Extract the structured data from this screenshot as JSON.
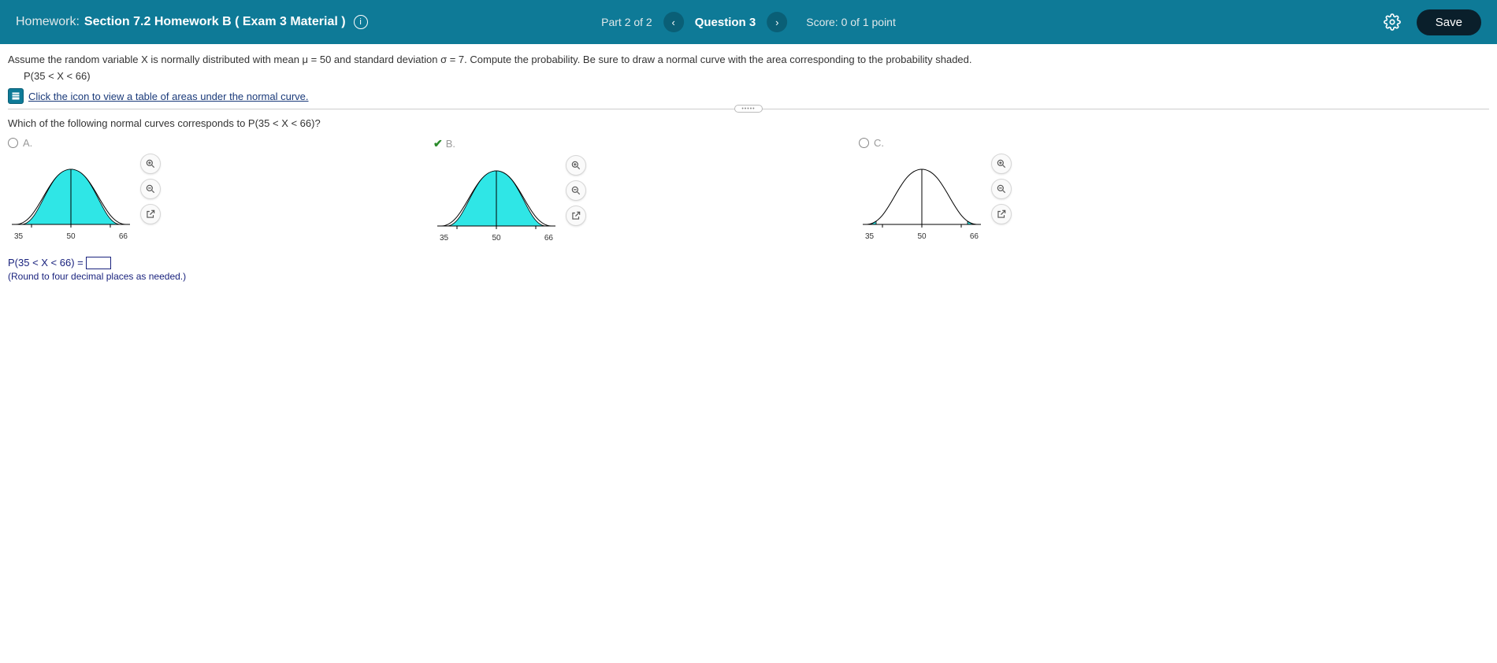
{
  "header": {
    "homework_label": "Homework:",
    "homework_title": "Section 7.2 Homework B ( Exam 3 Material )",
    "part_text": "Part 2 of 2",
    "question_text": "Question 3",
    "score_text": "Score: 0 of 1 point",
    "save_label": "Save"
  },
  "problem": {
    "statement": "Assume the random variable X is normally distributed with mean μ = 50 and standard deviation σ = 7. Compute the probability. Be sure to draw a normal curve with the area corresponding to the probability shaded.",
    "expression": "P(35 < X < 66)",
    "link_text": "Click the icon to view a table of areas under the normal curve."
  },
  "question": {
    "prompt": "Which of the following normal curves corresponds to P(35 < X < 66)?",
    "options": [
      {
        "label": "A.",
        "selected": false,
        "correct": false,
        "ticks": [
          "35",
          "50",
          "66"
        ],
        "shade": "full"
      },
      {
        "label": "B.",
        "selected": true,
        "correct": true,
        "ticks": [
          "35",
          "50",
          "66"
        ],
        "shade": "full"
      },
      {
        "label": "C.",
        "selected": false,
        "correct": false,
        "ticks": [
          "35",
          "50",
          "66"
        ],
        "shade": "tails"
      }
    ]
  },
  "answer": {
    "prefix": "P(35 < X < 66) =",
    "value": "",
    "hint": "(Round to four decimal places as needed.)"
  },
  "chart_data": [
    {
      "type": "area",
      "title": "Option A",
      "xlabel": "",
      "ylabel": "",
      "x_ticks": [
        35,
        50,
        66
      ],
      "mean": 50,
      "sd": 7,
      "shaded_interval": [
        35,
        66
      ]
    },
    {
      "type": "area",
      "title": "Option B",
      "xlabel": "",
      "ylabel": "",
      "x_ticks": [
        35,
        50,
        66
      ],
      "mean": 50,
      "sd": 7,
      "shaded_interval": [
        35,
        66
      ]
    },
    {
      "type": "area",
      "title": "Option C",
      "xlabel": "",
      "ylabel": "",
      "x_ticks": [
        35,
        50,
        66
      ],
      "mean": 50,
      "sd": 7,
      "shaded_intervals": [
        [
          29,
          35
        ],
        [
          66,
          71
        ]
      ]
    }
  ]
}
